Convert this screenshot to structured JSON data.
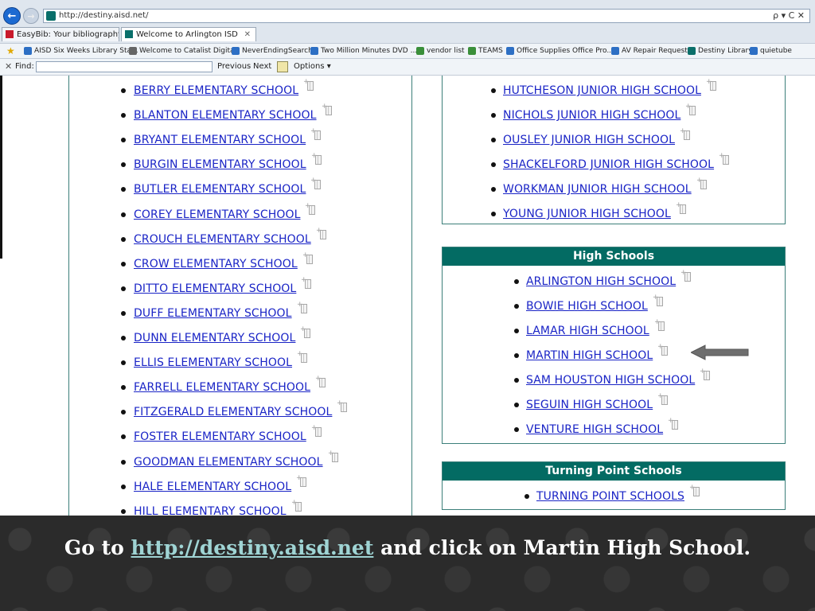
{
  "browser": {
    "url": "http://destiny.aisd.net/",
    "controls": "ρ ▾ C ✕",
    "tabs": [
      {
        "label": "EasyBib: Your bibliography / w..."
      },
      {
        "label": "Welcome to Arlington ISD",
        "close": "✕"
      }
    ],
    "favorites": [
      {
        "label": "AISD Six Weeks Library Sta...",
        "color": "#2d6fc4"
      },
      {
        "label": "Welcome to Catalist Digital!",
        "color": "#666666"
      },
      {
        "label": "NeverEndingSearch",
        "color": "#2d6fc4"
      },
      {
        "label": "Two Million Minutes DVD ...",
        "color": "#2d6fc4"
      },
      {
        "label": "vendor list",
        "color": "#3a8f3a"
      },
      {
        "label": "TEAMS",
        "color": "#3a8f3a"
      },
      {
        "label": "Office Supplies Office Pro...",
        "color": "#2d6fc4"
      },
      {
        "label": "AV Repair Request",
        "color": "#2d6fc4"
      },
      {
        "label": "Destiny Library",
        "color": "#0a6f6a"
      },
      {
        "label": "quietube",
        "color": "#2d6fc4"
      }
    ],
    "find": {
      "label": "Find:",
      "previous": "Previous",
      "next": "Next",
      "options": "Options ▾"
    }
  },
  "elementary_schools": [
    "BERRY ELEMENTARY SCHOOL",
    "BLANTON ELEMENTARY SCHOOL",
    "BRYANT ELEMENTARY SCHOOL",
    "BURGIN ELEMENTARY SCHOOL",
    "BUTLER ELEMENTARY SCHOOL",
    "COREY ELEMENTARY SCHOOL",
    "CROUCH ELEMENTARY SCHOOL",
    "CROW ELEMENTARY SCHOOL",
    "DITTO ELEMENTARY SCHOOL",
    "DUFF ELEMENTARY SCHOOL",
    "DUNN ELEMENTARY SCHOOL",
    "ELLIS ELEMENTARY SCHOOL",
    "FARRELL ELEMENTARY SCHOOL",
    "FITZGERALD ELEMENTARY SCHOOL",
    "FOSTER ELEMENTARY SCHOOL",
    "GOODMAN ELEMENTARY SCHOOL",
    "HALE ELEMENTARY SCHOOL",
    "HILL ELEMENTARY SCHOOL"
  ],
  "junior_high_schools": [
    "HUTCHESON JUNIOR HIGH SCHOOL",
    "NICHOLS JUNIOR HIGH SCHOOL",
    "OUSLEY JUNIOR HIGH SCHOOL",
    "SHACKELFORD JUNIOR HIGH SCHOOL",
    "WORKMAN JUNIOR HIGH SCHOOL",
    "YOUNG JUNIOR HIGH SCHOOL"
  ],
  "high_schools": {
    "title": "High Schools",
    "items": [
      "ARLINGTON HIGH SCHOOL",
      "BOWIE HIGH SCHOOL",
      "LAMAR HIGH SCHOOL",
      "MARTIN HIGH SCHOOL",
      "SAM HOUSTON HIGH SCHOOL",
      "SEGUIN HIGH SCHOOL",
      "VENTURE HIGH SCHOOL"
    ]
  },
  "turning_point": {
    "title": "Turning Point Schools",
    "items": [
      "TURNING POINT SCHOOLS"
    ]
  },
  "caption": {
    "before": "Go to ",
    "link": "http://destiny.aisd.net",
    "after": " and click on Martin High School."
  },
  "colors": {
    "link": "#1a24c6",
    "header_bg": "#036b63"
  }
}
